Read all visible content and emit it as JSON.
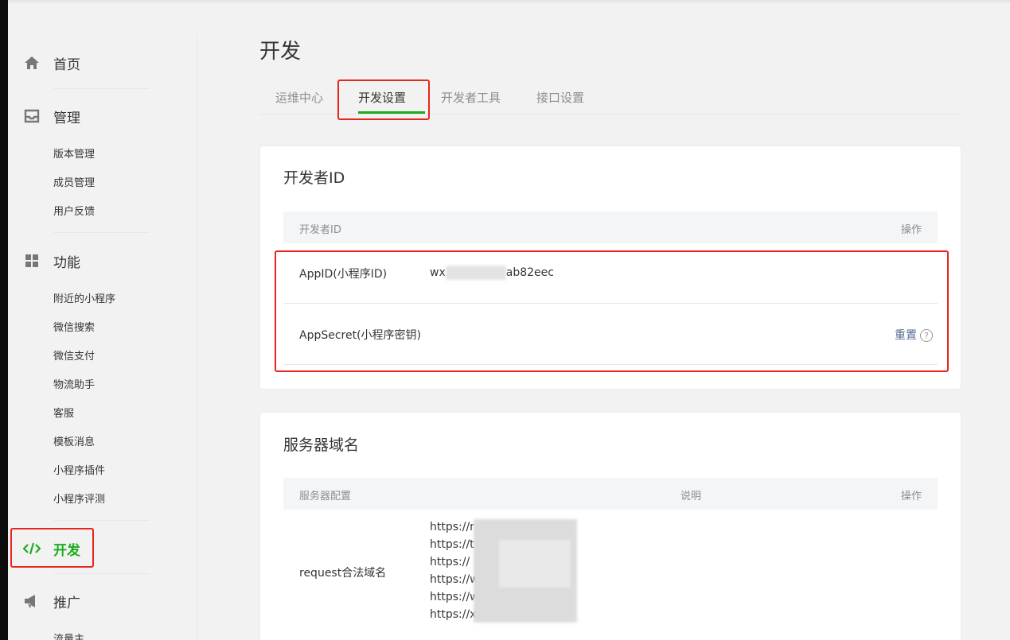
{
  "sidebar": {
    "sections": [
      {
        "label": "首页",
        "icon": "home-icon"
      },
      {
        "label": "管理",
        "icon": "inbox-icon",
        "items": [
          "版本管理",
          "成员管理",
          "用户反馈"
        ]
      },
      {
        "label": "功能",
        "icon": "grid-icon",
        "items": [
          "附近的小程序",
          "微信搜索",
          "微信支付",
          "物流助手",
          "客服",
          "模板消息",
          "小程序插件",
          "小程序评测"
        ]
      },
      {
        "label": "开发",
        "icon": "code-icon"
      },
      {
        "label": "推广",
        "icon": "megaphone-icon",
        "items": [
          "流量主"
        ]
      }
    ]
  },
  "page": {
    "title": "开发"
  },
  "tabs": [
    "运维中心",
    "开发设置",
    "开发者工具",
    "接口设置"
  ],
  "developer_id": {
    "title": "开发者ID",
    "columns": [
      "开发者ID",
      "操作"
    ],
    "rows": [
      {
        "label": "AppID(小程序ID)",
        "value_prefix": "wx",
        "value_suffix": "ab82eec"
      },
      {
        "label": "AppSecret(小程序密钥)",
        "action": "重置",
        "help_icon": "?"
      }
    ]
  },
  "server_domain": {
    "title": "服务器域名",
    "columns": [
      "服务器配置",
      "说明",
      "操作"
    ],
    "rows": [
      {
        "label": "request合法域名",
        "urls": [
          "https://r",
          "https://t",
          "https://",
          "https://w",
          "https://w",
          "https://x"
        ]
      }
    ]
  },
  "colors": {
    "accent": "#1aad19",
    "link": "#576b95",
    "highlight": "#e8251d"
  }
}
